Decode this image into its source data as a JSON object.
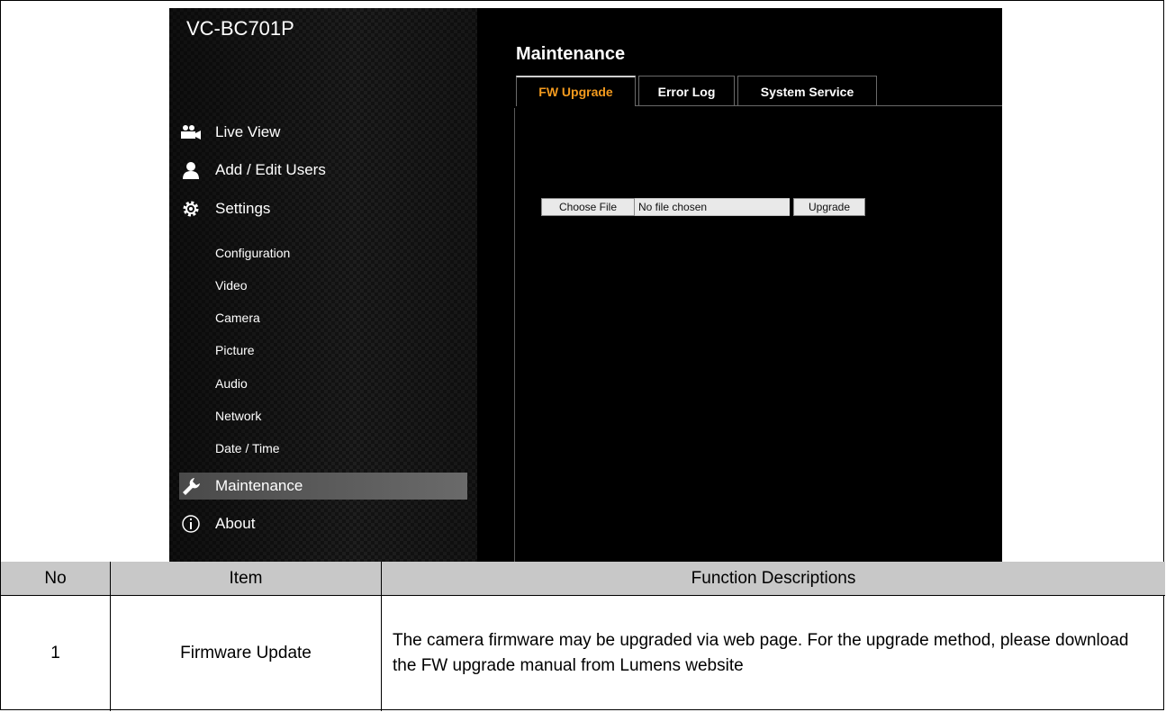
{
  "device": {
    "model": "VC-BC701P"
  },
  "nav": {
    "live_view": "Live View",
    "add_edit_users": "Add / Edit Users",
    "settings": "Settings",
    "sub_items": [
      "Configuration",
      "Video",
      "Camera",
      "Picture",
      "Audio",
      "Network",
      "Date / Time"
    ],
    "maintenance": "Maintenance",
    "about": "About"
  },
  "main": {
    "title": "Maintenance",
    "tabs": [
      "FW Upgrade",
      "Error Log",
      "System Service"
    ],
    "choose_file": "Choose File",
    "no_file": "No file chosen",
    "upgrade": "Upgrade"
  },
  "table": {
    "headers": {
      "no": "No",
      "item": "Item",
      "desc": "Function Descriptions"
    },
    "rows": [
      {
        "no": "1",
        "item": "Firmware Update",
        "desc": "The camera firmware may be upgraded via web page. For the upgrade method, please download the FW upgrade manual from Lumens website"
      }
    ]
  },
  "colors": {
    "active_tab": "#f39a1e",
    "header_bg": "#c8c8c8"
  }
}
